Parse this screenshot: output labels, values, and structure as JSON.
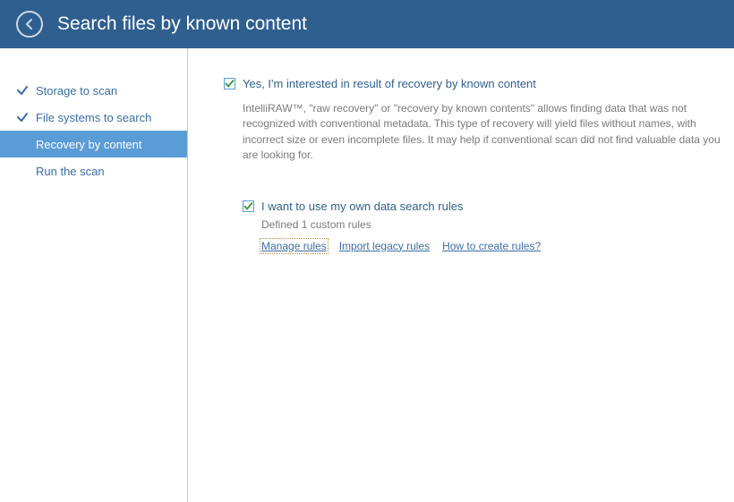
{
  "header": {
    "title": "Search files by known content"
  },
  "sidebar": {
    "items": [
      {
        "label": "Storage to scan",
        "done": true,
        "selected": false
      },
      {
        "label": "File systems to search",
        "done": true,
        "selected": false
      },
      {
        "label": "Recovery by content",
        "done": false,
        "selected": true
      },
      {
        "label": "Run the scan",
        "done": false,
        "selected": false
      }
    ]
  },
  "main": {
    "opt_known_content_label": "Yes, I'm interested in result of recovery by known content",
    "description": "IntelliRAW™, \"raw recovery\" or \"recovery by known contents\" allows finding data that was not recognized with conventional metadata. This type of recovery will yield files without names, with incorrect size or even incomplete files. It may help if conventional scan did not find valuable data you are looking for.",
    "opt_own_rules_label": "I want to use my own data search rules",
    "defined_rules": "Defined 1 custom rules",
    "link_manage": "Manage rules",
    "link_import": "Import legacy rules",
    "link_howto": "How to create rules?"
  },
  "colors": {
    "header_bg": "#2f5f8f",
    "accent": "#5a9cd6",
    "link": "#3a6ea5",
    "check_green": "#3a9a3a"
  }
}
